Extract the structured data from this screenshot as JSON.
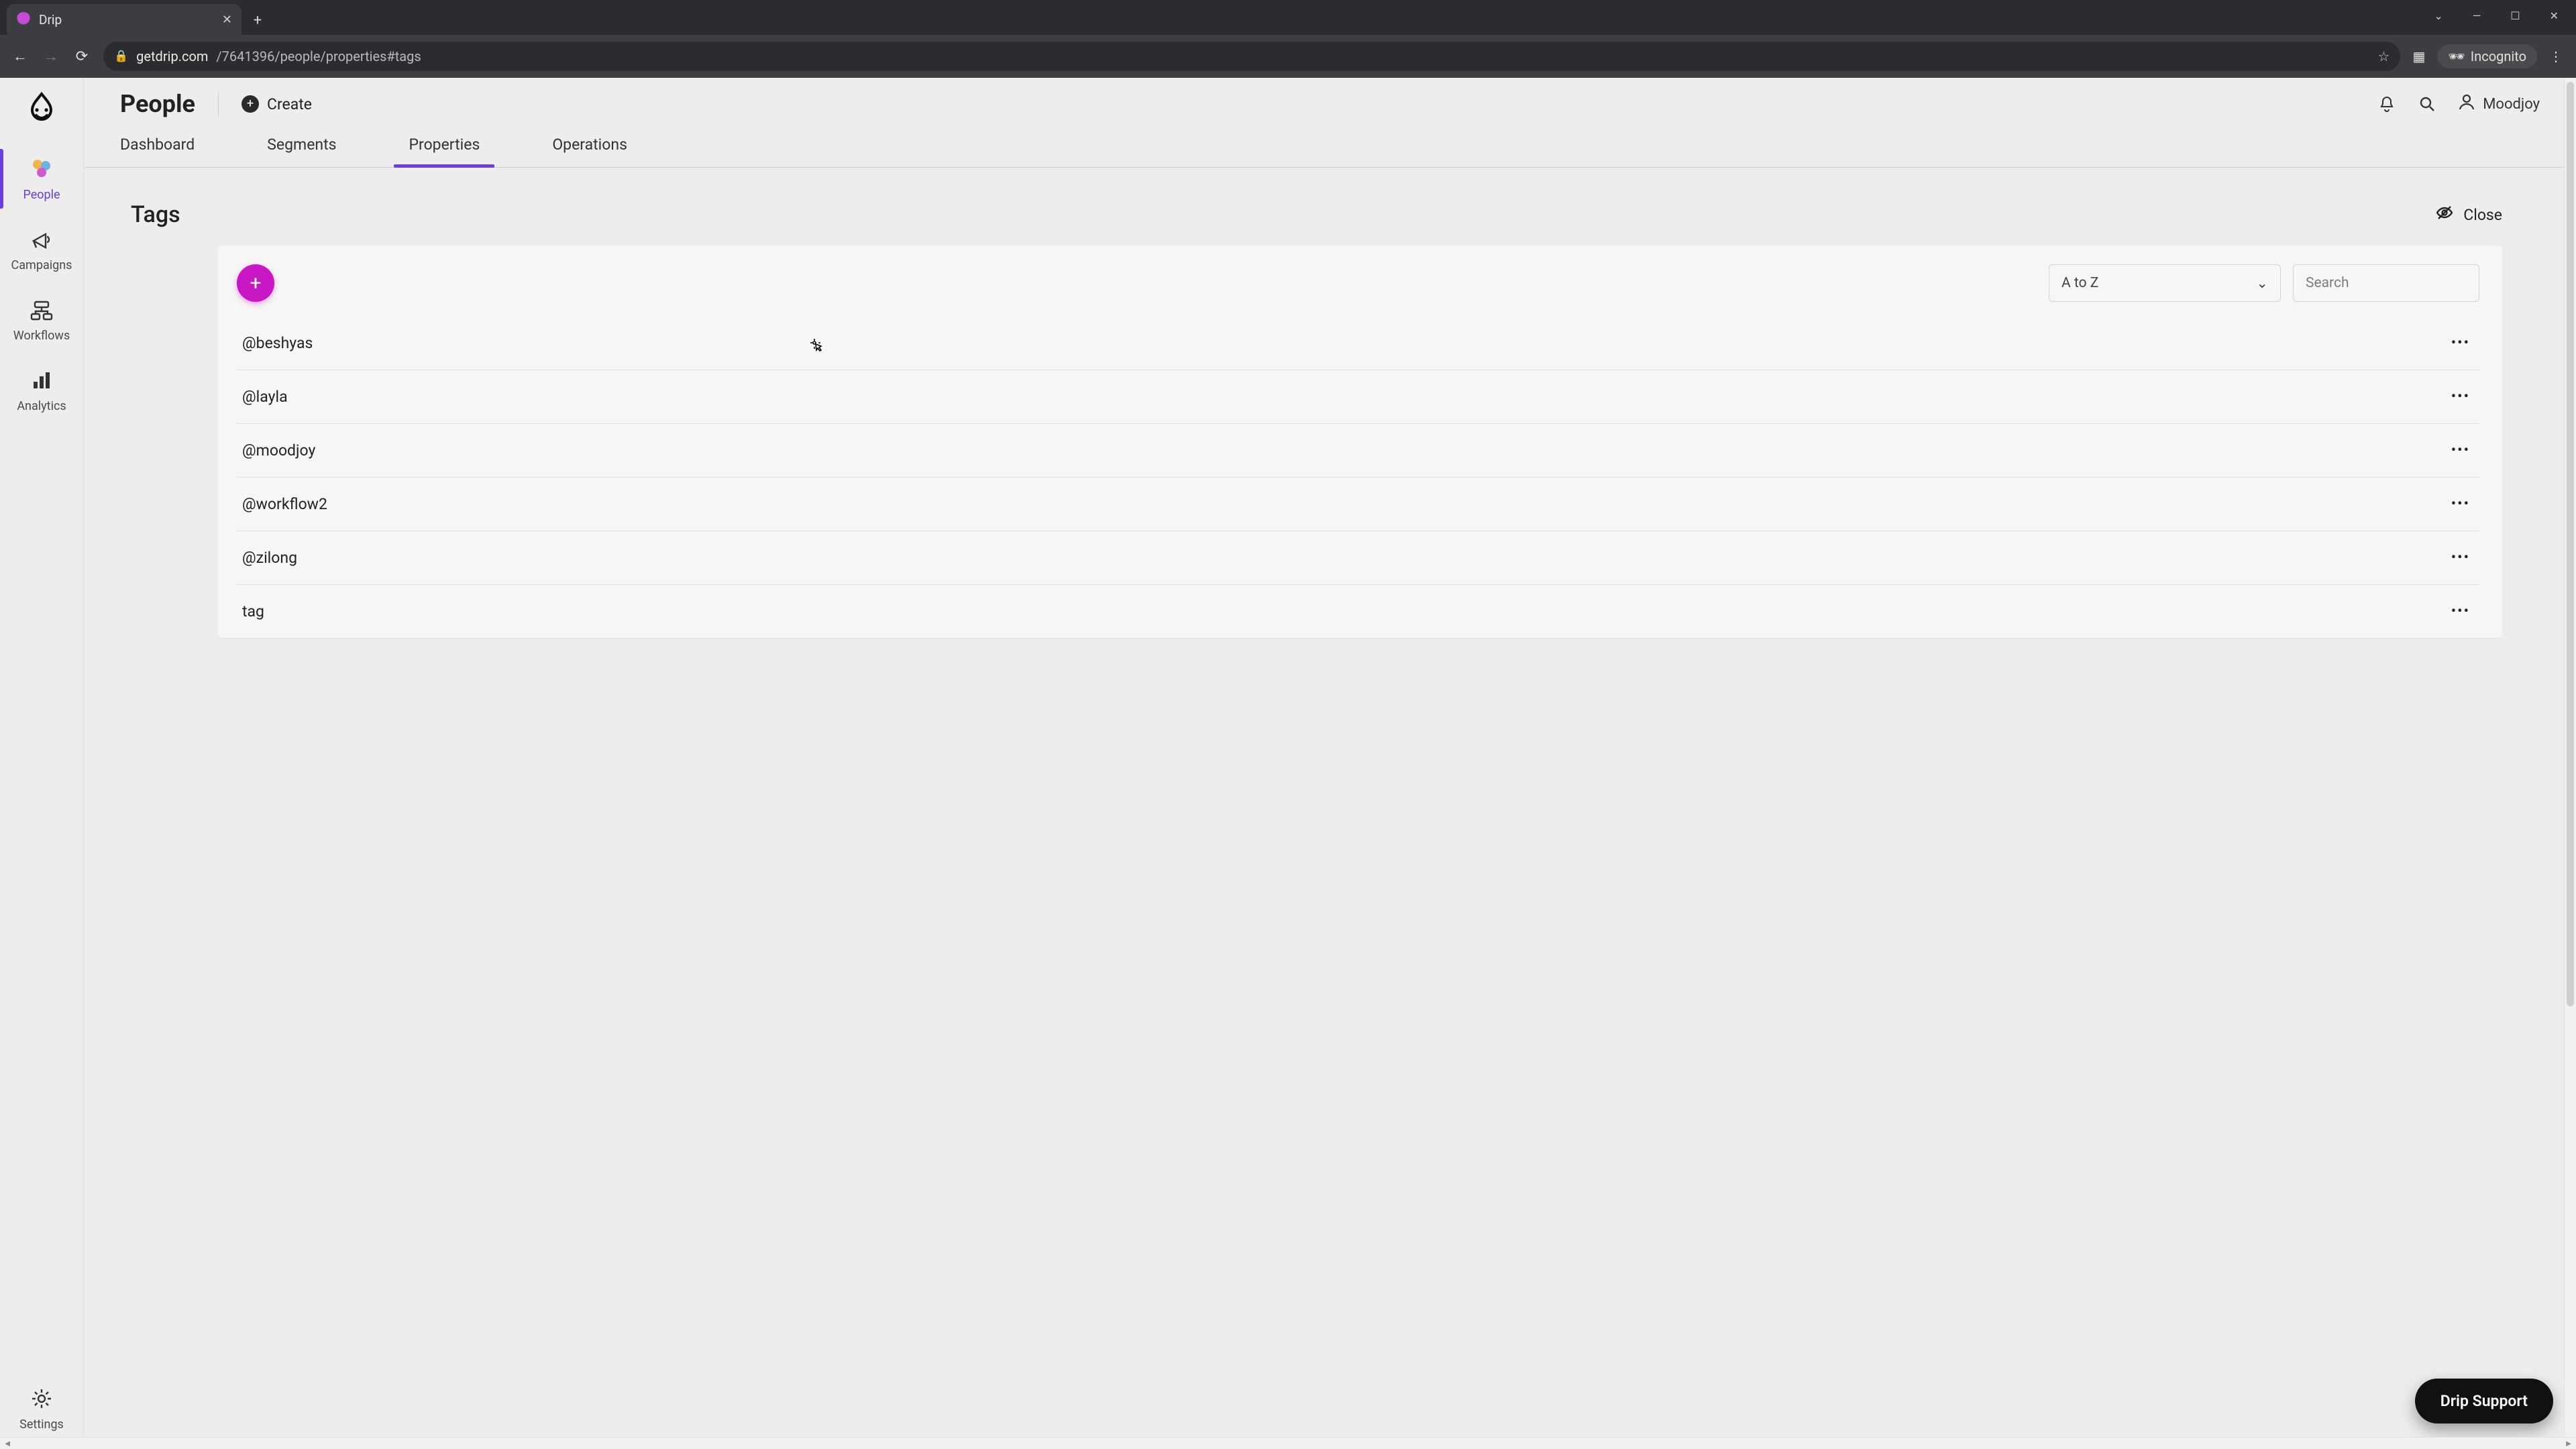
{
  "browser": {
    "tab_title": "Drip",
    "url_domain": "getdrip.com",
    "url_path": "/7641396/people/properties#tags",
    "incognito_label": "Incognito"
  },
  "leftnav": {
    "items": [
      {
        "label": "People"
      },
      {
        "label": "Campaigns"
      },
      {
        "label": "Workflows"
      },
      {
        "label": "Analytics"
      }
    ],
    "settings_label": "Settings"
  },
  "header": {
    "page_title": "People",
    "create_label": "Create",
    "user_name": "Moodjoy"
  },
  "tabs": [
    {
      "label": "Dashboard"
    },
    {
      "label": "Segments"
    },
    {
      "label": "Properties"
    },
    {
      "label": "Operations"
    }
  ],
  "section": {
    "title": "Tags",
    "close_label": "Close"
  },
  "toolbar": {
    "sort_label": "A to Z",
    "search_placeholder": "Search"
  },
  "tags": [
    {
      "name": "@beshyas"
    },
    {
      "name": "@layla"
    },
    {
      "name": "@moodjoy"
    },
    {
      "name": "@workflow2"
    },
    {
      "name": "@zilong"
    },
    {
      "name": "tag"
    }
  ],
  "support": {
    "label": "Drip Support"
  }
}
